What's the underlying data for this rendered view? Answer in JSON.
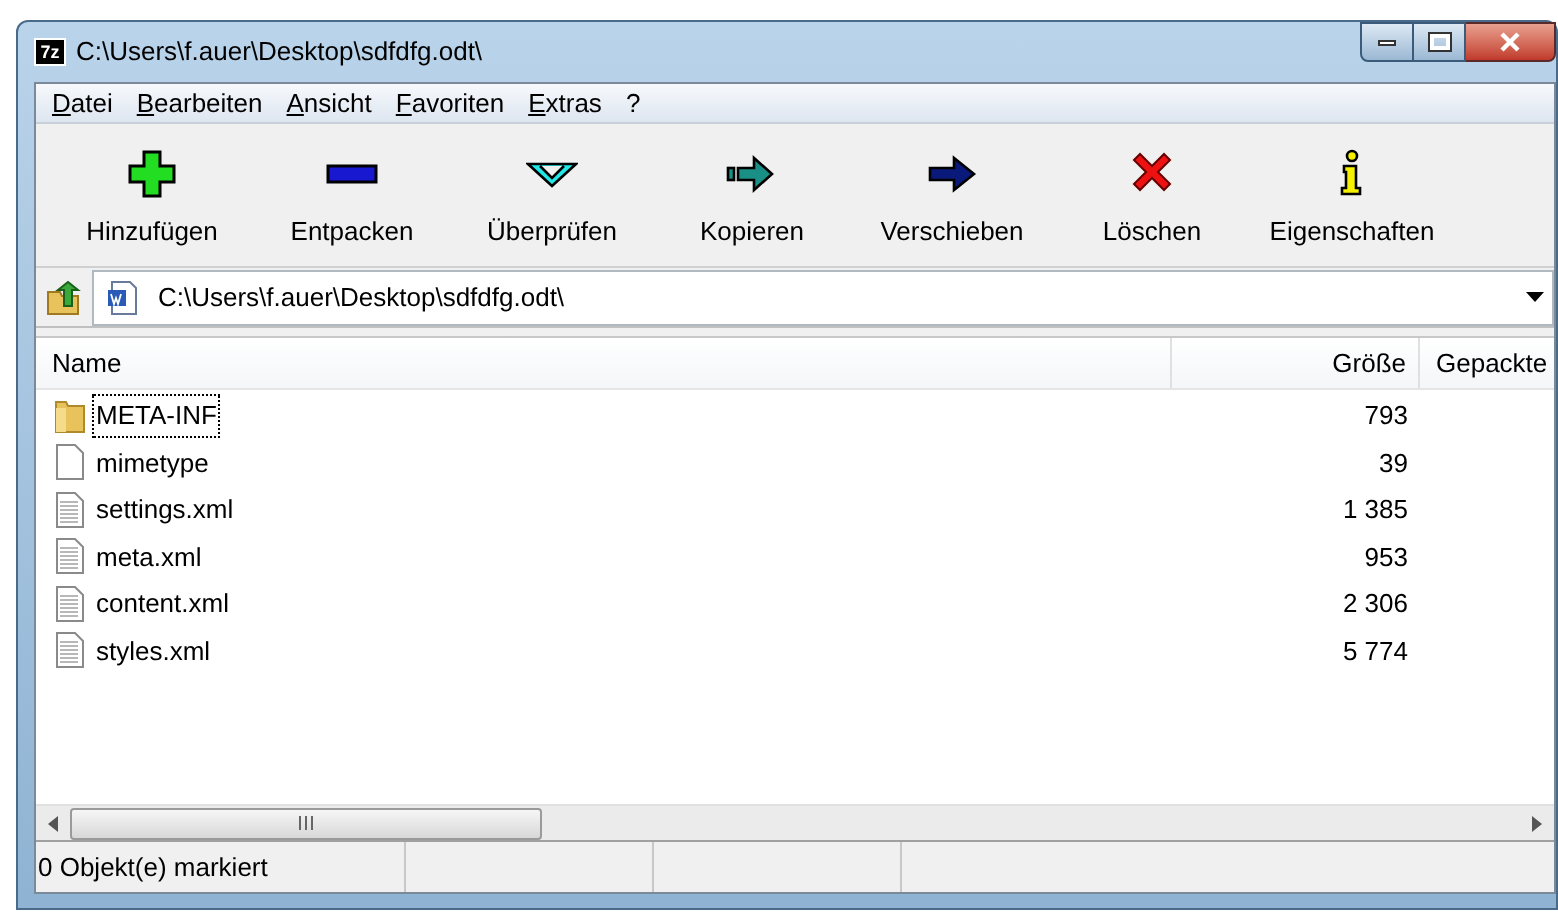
{
  "window": {
    "app_icon": "7z",
    "title": "C:\\Users\\f.auer\\Desktop\\sdfdfg.odt\\"
  },
  "menu": [
    "Datei",
    "Bearbeiten",
    "Ansicht",
    "Favoriten",
    "Extras",
    "?"
  ],
  "toolbar": [
    {
      "label": "Hinzufügen",
      "kind": "add"
    },
    {
      "label": "Entpacken",
      "kind": "extract"
    },
    {
      "label": "Überprüfen",
      "kind": "test"
    },
    {
      "label": "Kopieren",
      "kind": "copy"
    },
    {
      "label": "Verschieben",
      "kind": "move"
    },
    {
      "label": "Löschen",
      "kind": "delete"
    },
    {
      "label": "Eigenschaften",
      "kind": "info"
    }
  ],
  "address": {
    "value": "C:\\Users\\f.auer\\Desktop\\sdfdfg.odt\\"
  },
  "table": {
    "columns": [
      "Name",
      "Größe",
      "Gepackte"
    ],
    "rows": [
      {
        "name": "META-INF",
        "size": "793",
        "kind": "folder",
        "focused": true
      },
      {
        "name": "mimetype",
        "size": "39",
        "kind": "file",
        "focused": false
      },
      {
        "name": "settings.xml",
        "size": "1 385",
        "kind": "text",
        "focused": false
      },
      {
        "name": "meta.xml",
        "size": "953",
        "kind": "text",
        "focused": false
      },
      {
        "name": "content.xml",
        "size": "2 306",
        "kind": "text",
        "focused": false
      },
      {
        "name": "styles.xml",
        "size": "5 774",
        "kind": "text",
        "focused": false
      }
    ]
  },
  "status_bar": [
    "0 Objekt(e) markiert"
  ]
}
